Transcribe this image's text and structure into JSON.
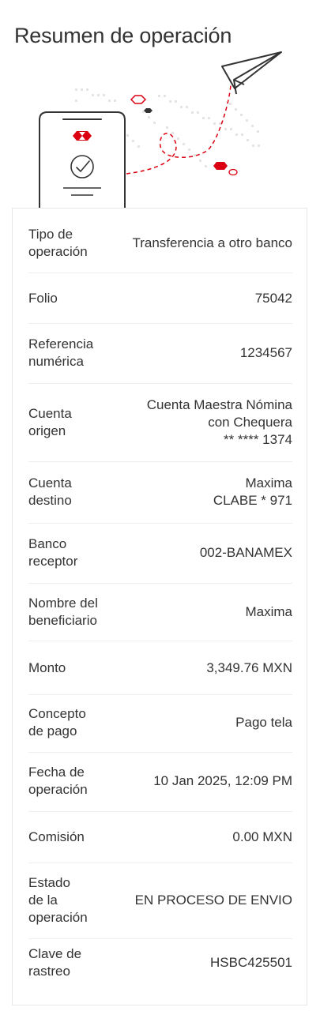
{
  "title": "Resumen de operación",
  "colors": {
    "brand_red": "#db0011",
    "text": "#333333",
    "divider": "#eeeeee"
  },
  "rows": [
    {
      "label_lines": [
        "Tipo de",
        "operación"
      ],
      "value_lines": [
        "Transferencia a otro banco"
      ]
    },
    {
      "label_lines": [
        "Folio"
      ],
      "value_lines": [
        "75042"
      ]
    },
    {
      "label_lines": [
        "Referencia",
        "numérica"
      ],
      "value_lines": [
        "1234567"
      ]
    },
    {
      "label_lines": [
        "Cuenta",
        "origen"
      ],
      "value_lines": [
        "Cuenta Maestra Nómina",
        "con Chequera",
        "** **** 1374"
      ]
    },
    {
      "label_lines": [
        "Cuenta",
        "destino"
      ],
      "value_lines": [
        "Maxima",
        "CLABE * 971"
      ]
    },
    {
      "label_lines": [
        "Banco",
        "receptor"
      ],
      "value_lines": [
        "002-BANAMEX"
      ]
    },
    {
      "label_lines": [
        "Nombre del",
        "beneficiario"
      ],
      "value_lines": [
        "Maxima"
      ]
    },
    {
      "label_lines": [
        "Monto"
      ],
      "value_lines": [
        "3,349.76 MXN"
      ]
    },
    {
      "label_lines": [
        "Concepto",
        "de pago"
      ],
      "value_lines": [
        "Pago tela"
      ]
    },
    {
      "label_lines": [
        "Fecha de",
        "operación"
      ],
      "value_lines": [
        "10 Jan 2025, 12:09 PM"
      ]
    },
    {
      "label_lines": [
        "Comisión"
      ],
      "value_lines": [
        "0.00 MXN"
      ]
    },
    {
      "label_lines": [
        "Estado",
        "de la",
        "operación"
      ],
      "value_lines": [
        "EN PROCESO DE ENVIO"
      ]
    },
    {
      "label_lines": [
        "Clave de",
        "rastreo"
      ],
      "value_lines": [
        "HSBC425501"
      ]
    }
  ]
}
